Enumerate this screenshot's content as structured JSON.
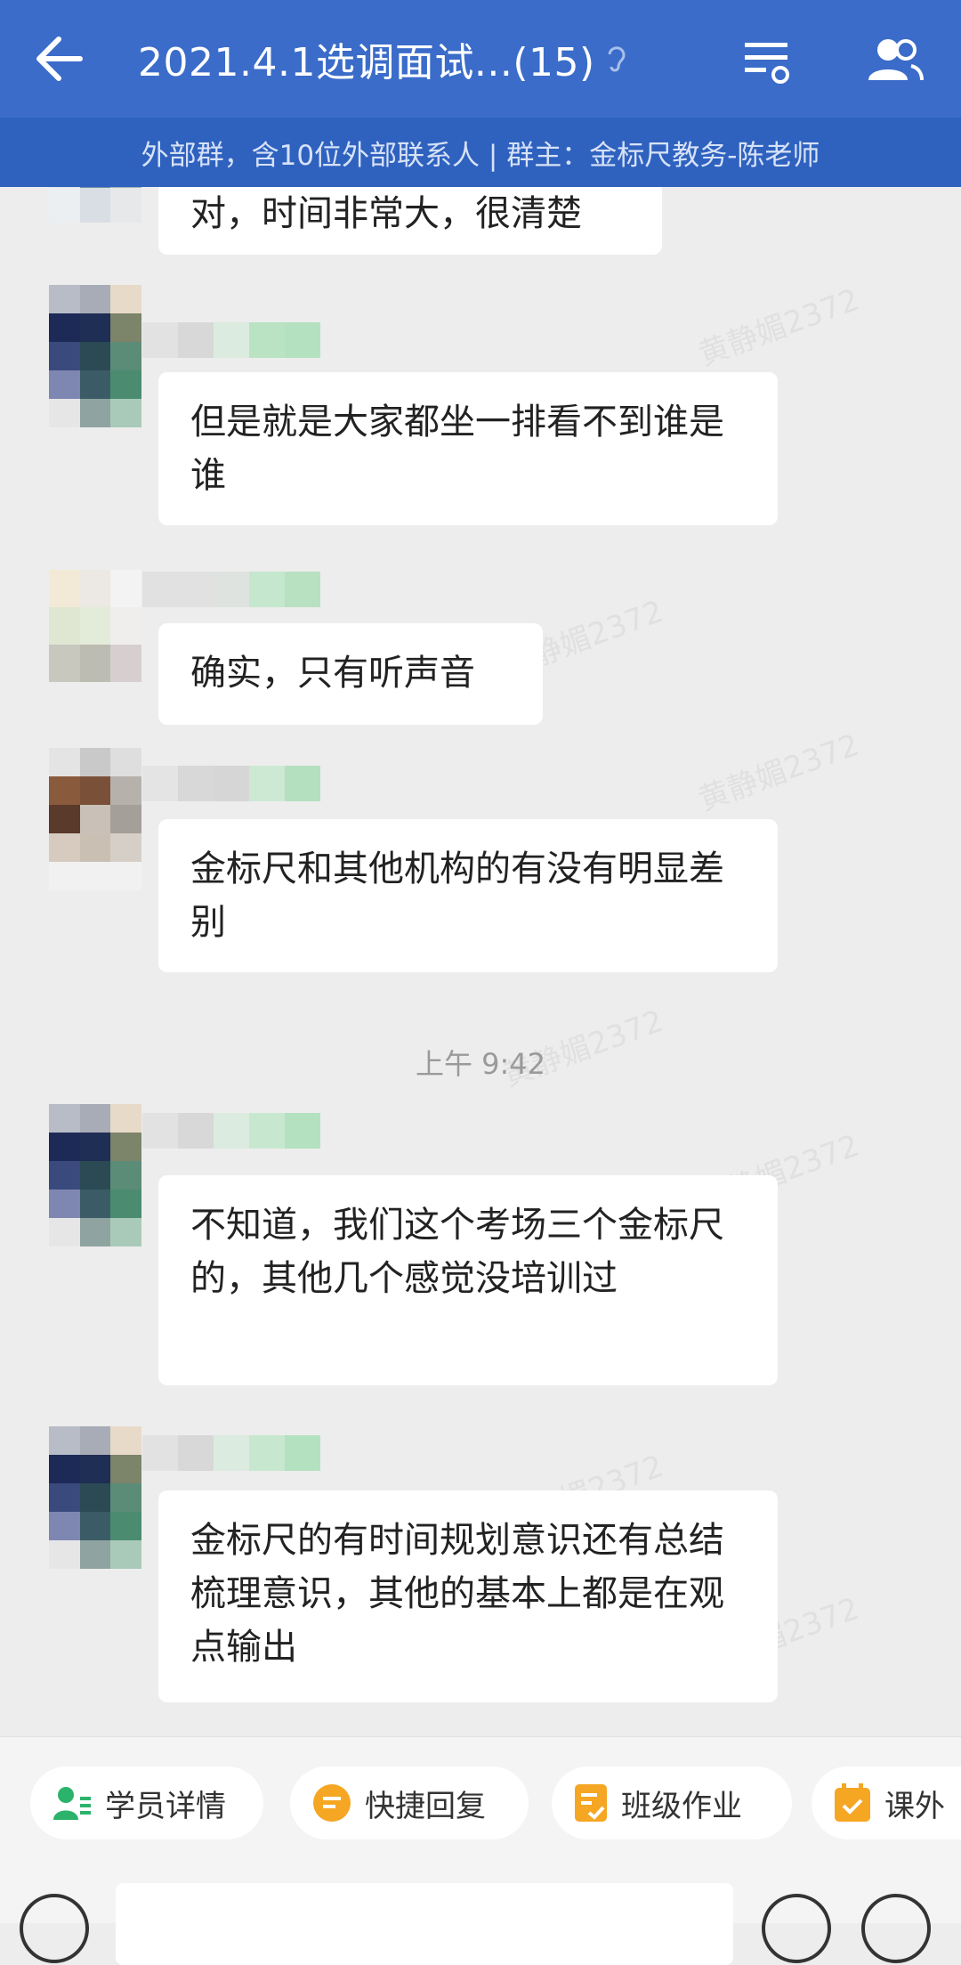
{
  "header": {
    "title": "2021.4.1选调面试...(15)",
    "subtitle": "外部群，含10位外部联系人 | 群主：金标尺教务-陈老师"
  },
  "messages": [
    {
      "text": "对，时间非常大，很清楚"
    },
    {
      "text": "但是就是大家都坐一排看不到谁是谁"
    },
    {
      "text": "确实，只有听声音"
    },
    {
      "text": "金标尺和其他机构的有没有明显差别"
    },
    {
      "text": "不知道，我们这个考场三个金标尺的，其他几个感觉没培训过"
    },
    {
      "text": "金标尺的有时间规划意识还有总结梳理意识，其他的基本上都是在观点输出"
    }
  ],
  "timestamp": "上午 9:42",
  "watermark": "黄静媚2372",
  "quick_actions": [
    {
      "label": "学员详情",
      "icon": "student-icon"
    },
    {
      "label": "快捷回复",
      "icon": "quick-reply-icon"
    },
    {
      "label": "班级作业",
      "icon": "homework-icon"
    },
    {
      "label": "课外",
      "icon": "calendar-icon"
    }
  ],
  "colors": {
    "header": "#3b6cc9",
    "subheader": "#2f62bf",
    "background": "#ededed",
    "bubble": "#ffffff"
  }
}
